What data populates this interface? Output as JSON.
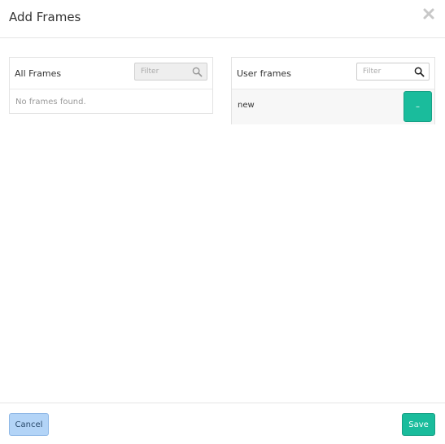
{
  "dialog": {
    "title": "Add Frames"
  },
  "all_frames": {
    "title": "All Frames",
    "filter_placeholder": "Filter",
    "empty_message": "No frames found."
  },
  "user_frames": {
    "title": "User frames",
    "filter_placeholder": "Filter",
    "items": [
      {
        "name": "new",
        "action_label": "–"
      }
    ]
  },
  "footer": {
    "cancel_label": "Cancel",
    "save_label": "Save"
  },
  "colors": {
    "accent": "#1abc9c",
    "cancel": "#b3d4f7"
  },
  "icons": [
    "close-icon",
    "search-icon"
  ]
}
